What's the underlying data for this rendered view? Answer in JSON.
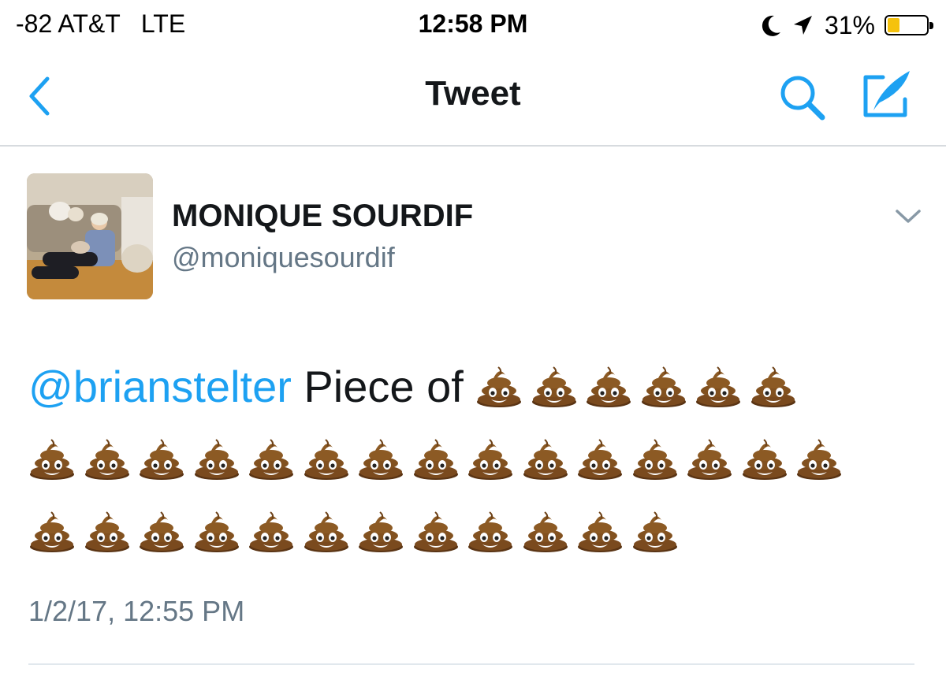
{
  "status_bar": {
    "signal": "-82 AT&T   LTE",
    "time": "12:58 PM",
    "battery_percent_text": "31%",
    "battery_level": 0.31,
    "icons": [
      "moon-icon",
      "location-arrow-icon",
      "battery-icon"
    ]
  },
  "nav": {
    "title": "Tweet",
    "icons": [
      "back-chevron-icon",
      "search-icon",
      "compose-icon"
    ]
  },
  "colors": {
    "accent": "#1da1f2",
    "text": "#14171a",
    "secondary": "#657786",
    "battery": "#f5c20d"
  },
  "tweet": {
    "display_name": "MONIQUE SOURDIF",
    "handle": "@moniquesourdif",
    "mention": "@brianstelter",
    "text": " Piece of ",
    "emoji": "pile-of-poo",
    "emoji_lines": [
      6,
      15,
      12
    ],
    "timestamp": "1/2/17, 12:55 PM"
  }
}
